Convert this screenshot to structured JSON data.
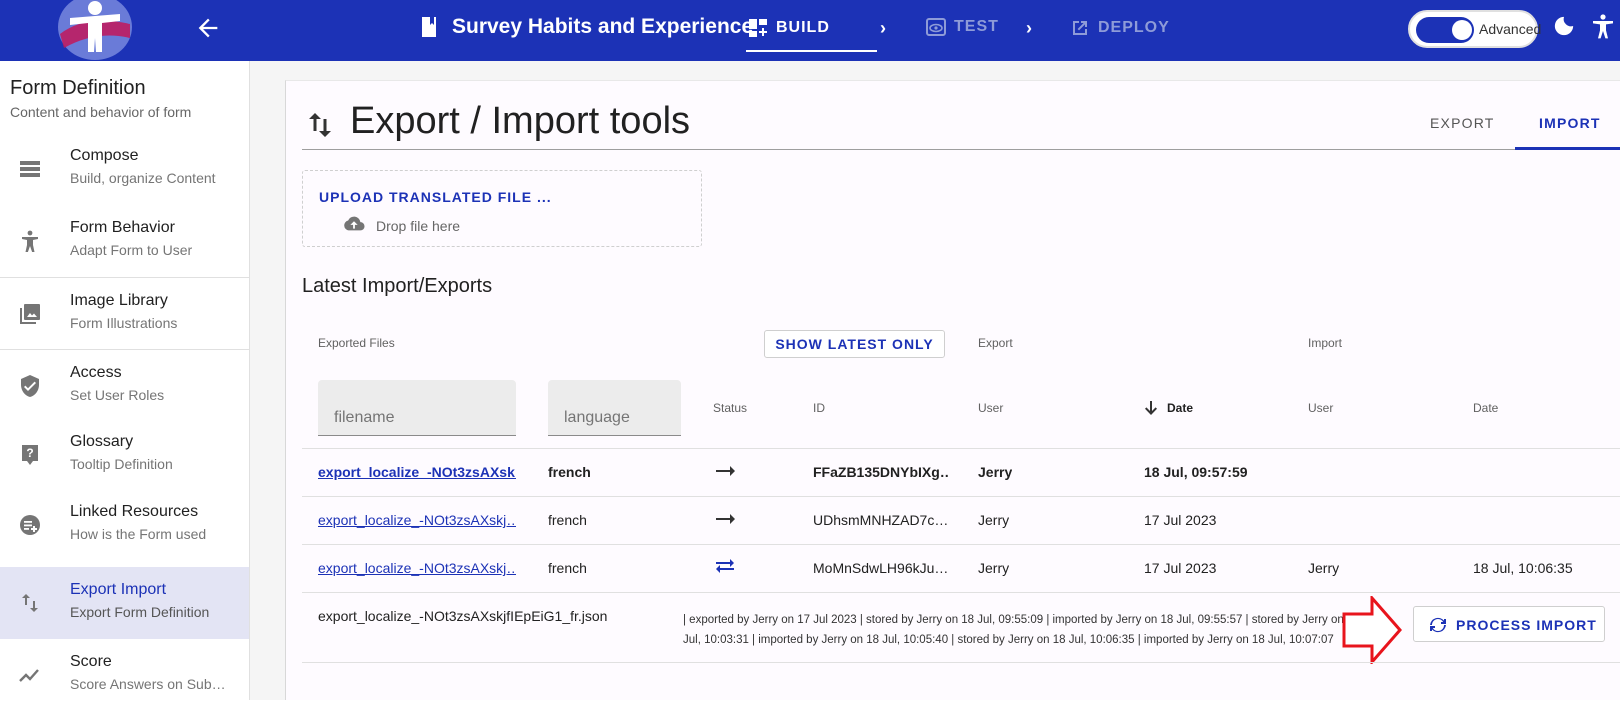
{
  "header": {
    "form_title": "Survey Habits and Experience",
    "steps": [
      {
        "label": "BUILD",
        "icon": "dashboard-plus-icon",
        "active": true
      },
      {
        "label": "TEST",
        "icon": "preview-icon",
        "active": false
      },
      {
        "label": "DEPLOY",
        "icon": "open-external-icon",
        "active": false
      }
    ],
    "advanced_label": "Advanced",
    "advanced_on": true,
    "accent_color": "#1c32b6"
  },
  "sidebar": {
    "title": "Form Definition",
    "subtitle": "Content and behavior of form",
    "items": [
      {
        "label": "Compose",
        "desc": "Build, organize Content",
        "icon": "list-icon"
      },
      {
        "label": "Form Behavior",
        "desc": "Adapt Form to User",
        "icon": "accessibility-icon"
      },
      {
        "label": "Image Library",
        "desc": "Form Illustrations",
        "icon": "image-library-icon"
      },
      {
        "label": "Access",
        "desc": "Set User Roles",
        "icon": "shield-check-icon"
      },
      {
        "label": "Glossary",
        "desc": "Tooltip Definition",
        "icon": "help-icon"
      },
      {
        "label": "Linked Resources",
        "desc": "How is the Form used",
        "icon": "linked-resources-icon"
      },
      {
        "label": "Export Import",
        "desc": "Export Form Definition",
        "icon": "swap-vertical-icon",
        "active": true
      },
      {
        "label": "Score",
        "desc": "Score Answers on Sub…",
        "icon": "score-chart-icon"
      }
    ]
  },
  "main": {
    "title": "Export / Import tools",
    "tabs": [
      {
        "label": "EXPORT",
        "active": false
      },
      {
        "label": "IMPORT",
        "active": true
      }
    ],
    "upload": {
      "button_label": "UPLOAD TRANSLATED FILE ...",
      "drop_text": "Drop file here"
    },
    "section_title": "Latest Import/Exports",
    "table": {
      "group_headers": {
        "exported_files": "Exported Files",
        "show_latest": "SHOW LATEST ONLY",
        "export": "Export",
        "import": "Import"
      },
      "filters": {
        "filename_placeholder": "filename",
        "language_placeholder": "language"
      },
      "columns": {
        "status": "Status",
        "id": "ID",
        "export_user": "User",
        "export_date": "Date",
        "import_user": "User",
        "import_date": "Date"
      },
      "rows": [
        {
          "filename": "export_localize_-NOt3zsAXsk…",
          "language": "french",
          "status": "export-arrow-icon",
          "id": "FFaZB135DNYbIXg…",
          "export_user": "Jerry",
          "export_date": "18 Jul, 09:57:59",
          "import_user": "",
          "import_date": "",
          "bold": true
        },
        {
          "filename": "export_localize_-NOt3zsAXskj…",
          "language": "french",
          "status": "export-arrow-icon",
          "id": "UDhsmMNHZAD7c…",
          "export_user": "Jerry",
          "export_date": "17 Jul 2023",
          "import_user": "",
          "import_date": ""
        },
        {
          "filename": "export_localize_-NOt3zsAXskj…",
          "language": "french",
          "status": "import-swap-icon",
          "id": "MoMnSdwLH96kJu…",
          "export_user": "Jerry",
          "export_date": "17 Jul 2023",
          "import_user": "Jerry",
          "import_date": "18 Jul, 10:06:35"
        }
      ],
      "detail": {
        "filename": "export_localize_-NOt3zsAXskjfIEpEiG1_fr.json",
        "log": "| exported by Jerry on 17 Jul 2023 | stored by Jerry on 18 Jul, 09:55:09 | imported by Jerry on 18 Jul, 09:55:57 | stored by Jerry on 18 Jul, 10:03:31 | imported by Jerry on 18 Jul, 10:05:40 | stored by Jerry on 18 Jul, 10:06:35 | imported by Jerry on 18 Jul, 10:07:07",
        "process_label": "PROCESS IMPORT"
      }
    }
  }
}
